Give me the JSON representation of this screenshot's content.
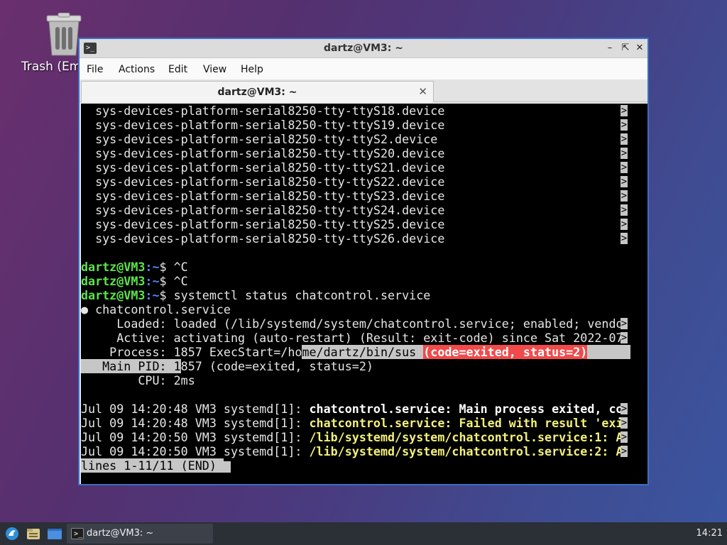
{
  "desktop": {
    "trash_label": "Trash (Em"
  },
  "window": {
    "title": "dartz@VM3: ~",
    "menu": [
      "File",
      "Actions",
      "Edit",
      "View",
      "Help"
    ],
    "tab_label": "dartz@VM3: ~"
  },
  "terminal": {
    "device_lines": [
      "  sys-devices-platform-serial8250-tty-ttyS18.device",
      "  sys-devices-platform-serial8250-tty-ttyS19.device",
      "  sys-devices-platform-serial8250-tty-ttyS2.device",
      "  sys-devices-platform-serial8250-tty-ttyS20.device",
      "  sys-devices-platform-serial8250-tty-ttyS21.device",
      "  sys-devices-platform-serial8250-tty-ttyS22.device",
      "  sys-devices-platform-serial8250-tty-ttyS23.device",
      "  sys-devices-platform-serial8250-tty-ttyS24.device",
      "  sys-devices-platform-serial8250-tty-ttyS25.device",
      "  sys-devices-platform-serial8250-tty-ttyS26.device"
    ],
    "prompt_user": "dartz@VM3",
    "prompt_path": ":~",
    "prompt_sign": "$ ",
    "cmd1": "^C",
    "cmd2": "^C",
    "cmd3": "systemctl status chatcontrol.service",
    "svc_line": "● chatcontrol.service",
    "loaded_line": "     Loaded: loaded (/lib/systemd/system/chatcontrol.service; enabled; vendo",
    "active_line": "     Active: activating (auto-restart) (Result: exit-code) since Sat 2022-07",
    "process_a": "    Process: 1857 ExecStart=/ho",
    "process_b": "me/dartz/bin/sus ",
    "process_c": "(code=exited, status=2)",
    "mainpid_a": "   Main PID: 1",
    "mainpid_b": "857 (code=exited, status=2)",
    "cpu_line": "        CPU: 2ms",
    "logs": [
      {
        "prefix": "Jul 09 14:20:48 VM3 systemd[1]: ",
        "msg": "chatcontrol.service: Main process exited, co",
        "color": "w"
      },
      {
        "prefix": "Jul 09 14:20:48 VM3 systemd[1]: ",
        "msg": "chatcontrol.service: Failed with result 'exi",
        "color": "y"
      },
      {
        "prefix": "Jul 09 14:20:50 VM3 systemd[1]: ",
        "msg": "/lib/systemd/system/chatcontrol.service:1: A",
        "color": "y"
      },
      {
        "prefix": "Jul 09 14:20:50 VM3 systemd[1]: ",
        "msg": "/lib/systemd/system/chatcontrol.service:2: A",
        "color": "y"
      }
    ],
    "status_line": "lines 1-11/11 (END)",
    "truncation_glyph": ">"
  },
  "taskbar": {
    "task_label": "dartz@VM3: ~",
    "clock": "14:21"
  },
  "colors": {
    "window_border": "#3a6fc4",
    "prompt_user": "#5ee34a",
    "prompt_path": "#4d8cf0",
    "error_highlight": "#f04a4a",
    "warning_text": "#f3f07a"
  }
}
